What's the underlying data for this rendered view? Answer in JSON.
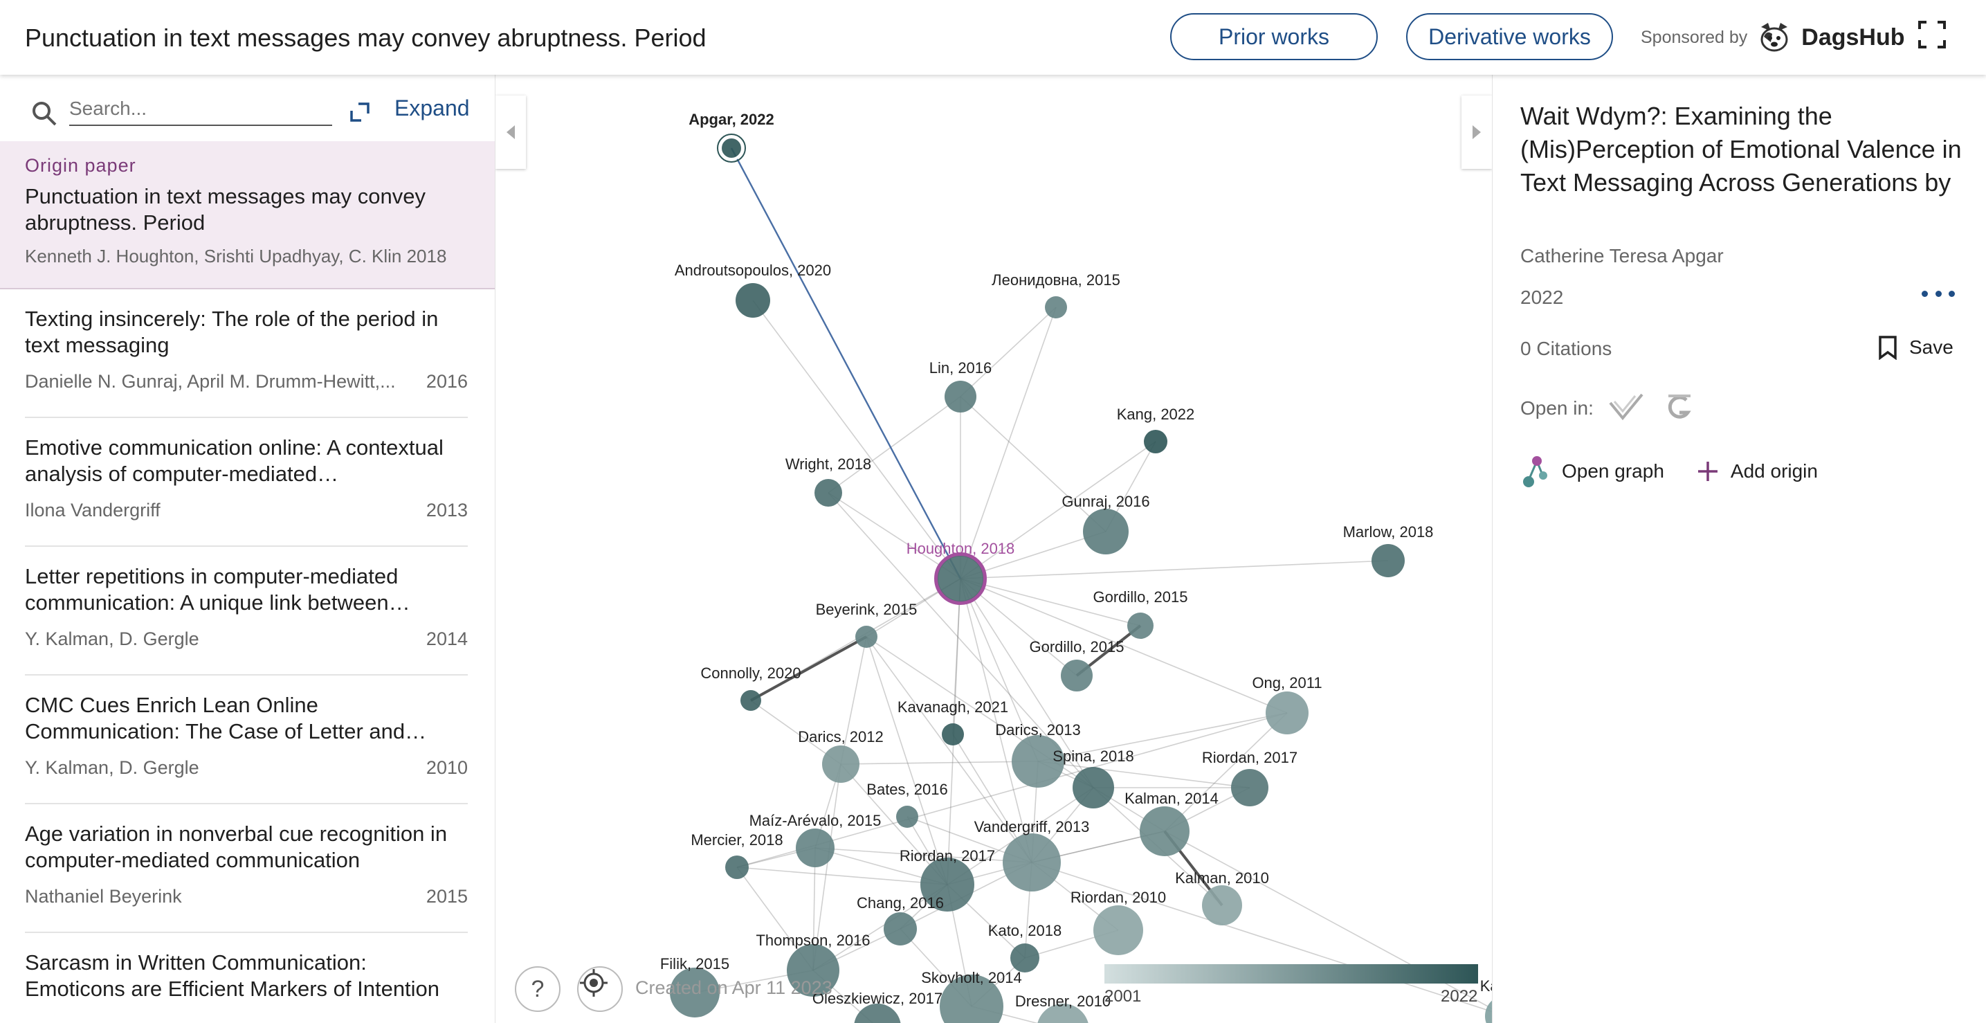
{
  "header": {
    "title": "Punctuation in text messages may convey abruptness. Period",
    "prior_works": "Prior works",
    "derivative_works": "Derivative works",
    "sponsored_by": "Sponsored by",
    "sponsor_name": "DagsHub"
  },
  "left": {
    "search_placeholder": "Search...",
    "expand_label": "Expand",
    "origin": {
      "tag": "Origin paper",
      "title": "Punctuation in text messages may convey abruptness. Period",
      "authors": "Kenneth J. Houghton, Srishti Upadhyay, C. Klin 2018"
    },
    "items": [
      {
        "title": "Texting insincerely: The role of the period in text messaging",
        "authors": "Danielle N. Gunraj, April M. Drumm-Hewitt,...",
        "year": "2016"
      },
      {
        "title": "Emotive communication online: A contextual analysis of computer-mediated…",
        "authors": "Ilona Vandergriff",
        "year": "2013"
      },
      {
        "title": "Letter repetitions in computer-mediated communication: A unique link between…",
        "authors": "Y. Kalman, D. Gergle",
        "year": "2014"
      },
      {
        "title": "CMC Cues Enrich Lean Online Communication: The Case of Letter and…",
        "authors": "Y. Kalman, D. Gergle",
        "year": "2010"
      },
      {
        "title": "Age variation in nonverbal cue recognition in computer-mediated communication",
        "authors": "Nathaniel Beyerink",
        "year": "2015"
      },
      {
        "title": "Sarcasm in Written Communication: Emoticons are Efficient Markers of Intention",
        "authors": "",
        "year": ""
      }
    ]
  },
  "graph": {
    "created_text": "Created on Apr 11 2023",
    "legend_min": "2001",
    "legend_max": "2022",
    "colors": {
      "dark": "#2d5556",
      "light": "#d3dfdf",
      "highlight": "#a3509e",
      "link": "#4a6fa5"
    },
    "nodes": [
      {
        "label": "Apgar, 2022",
        "year": 2022
      },
      {
        "label": "Androutsopoulos, 2020",
        "year": 2020
      },
      {
        "label": "Леонидовна, 2015",
        "year": 2015
      },
      {
        "label": "Lin, 2016",
        "year": 2016
      },
      {
        "label": "Kang, 2022",
        "year": 2022
      },
      {
        "label": "Wright, 2018",
        "year": 2018
      },
      {
        "label": "Gunraj, 2016",
        "year": 2016
      },
      {
        "label": "Houghton, 2018",
        "year": 2018
      },
      {
        "label": "Marlow, 2018",
        "year": 2018
      },
      {
        "label": "Beyerink, 2015",
        "year": 2015
      },
      {
        "label": "Gordillo, 2015",
        "year": 2015
      },
      {
        "label": "Gordillo, 2015",
        "year": 2015
      },
      {
        "label": "Connolly, 2020",
        "year": 2020
      },
      {
        "label": "Ong, 2011",
        "year": 2011
      },
      {
        "label": "Kavanagh, 2021",
        "year": 2021
      },
      {
        "label": "Darics, 2013",
        "year": 2013
      },
      {
        "label": "Spina, 2018",
        "year": 2018
      },
      {
        "label": "Riordan, 2017",
        "year": 2017
      },
      {
        "label": "Darics, 2012",
        "year": 2012
      },
      {
        "label": "Bates, 2016",
        "year": 2016
      },
      {
        "label": "Kalman, 2014",
        "year": 2014
      },
      {
        "label": "Maíz-Arévalo, 2015",
        "year": 2015
      },
      {
        "label": "Vandergriff, 2013",
        "year": 2013
      },
      {
        "label": "Mercier, 2018",
        "year": 2018
      },
      {
        "label": "Riordan, 2017",
        "year": 2017
      },
      {
        "label": "Kalman, 2010",
        "year": 2010
      },
      {
        "label": "Chang, 2016",
        "year": 2016
      },
      {
        "label": "Riordan, 2010",
        "year": 2010
      },
      {
        "label": "Thompson, 2016",
        "year": 2016
      },
      {
        "label": "Kato, 2018",
        "year": 2018
      },
      {
        "label": "Filik, 2015",
        "year": 2015
      },
      {
        "label": "Skovholt, 2014",
        "year": 2014
      },
      {
        "label": "Oleszkiewicz, 2017",
        "year": 2017
      },
      {
        "label": "Dresner, 2010",
        "year": 2010
      },
      {
        "label": "Kalman",
        "year": null
      }
    ]
  },
  "right": {
    "title": "Wait Wdym?: Examining the (Mis)Perception of Emotional Valence in Text Messaging Across Generations by",
    "authors": "Catherine Teresa Apgar",
    "year": "2022",
    "citations": "0 Citations",
    "save_label": "Save",
    "open_in": "Open in:",
    "open_graph": "Open graph",
    "add_origin": "Add origin"
  }
}
